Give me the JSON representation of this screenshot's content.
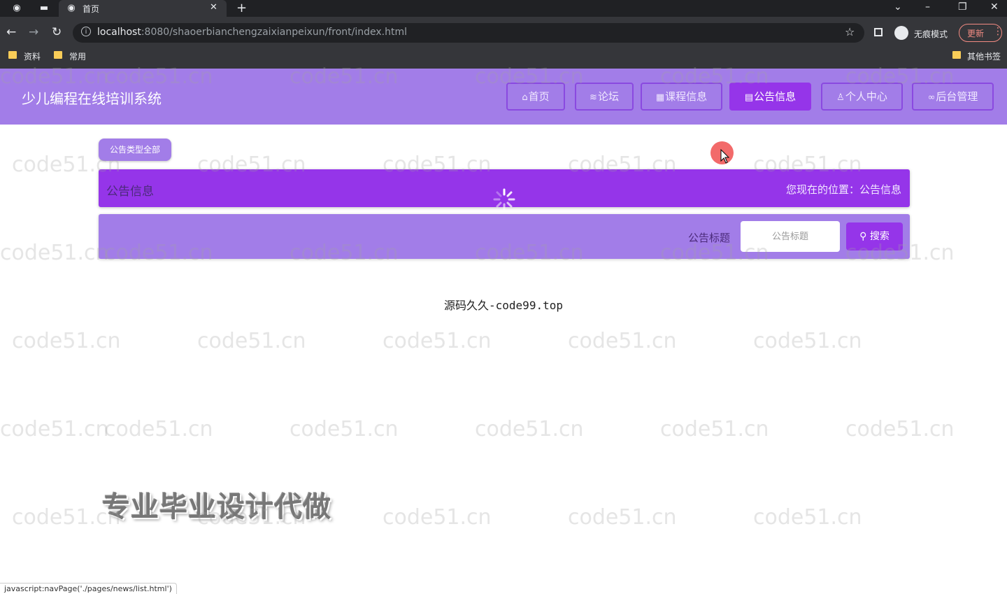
{
  "browser": {
    "tab_title": "首页",
    "url_host": "localhost",
    "url_path": ":8080/shaoerbianchengzaixianpeixun/front/index.html",
    "incognito_label": "无痕模式",
    "update_label": "更新",
    "bookmarks": [
      "资料",
      "常用"
    ],
    "other_bookmarks": "其他书签",
    "status_url": "javascript:navPage('./pages/news/list.html')"
  },
  "site": {
    "title": "少儿编程在线培训系统",
    "nav": [
      {
        "label": "首页",
        "icon": "home-icon",
        "active": false
      },
      {
        "label": "论坛",
        "icon": "layers-icon",
        "active": false
      },
      {
        "label": "课程信息",
        "icon": "grid-icon",
        "active": false
      },
      {
        "label": "公告信息",
        "icon": "document-icon",
        "active": true
      },
      {
        "label": "个人中心",
        "icon": "user-icon",
        "active": false
      },
      {
        "label": "后台管理",
        "icon": "link-icon",
        "active": false
      }
    ],
    "accent": "#9535e9",
    "header_color": "#a27de8"
  },
  "content": {
    "type_button": "公告类型全部",
    "breadcrumb_title": "公告信息",
    "breadcrumb_position": "您现在的位置：公告信息",
    "search_label": "公告标题",
    "search_placeholder": "公告标题",
    "search_button": "搜索"
  },
  "footer": {
    "text": "源码久久-code99.top",
    "promo": "专业毕业设计代做"
  },
  "watermark": "code51.cn"
}
